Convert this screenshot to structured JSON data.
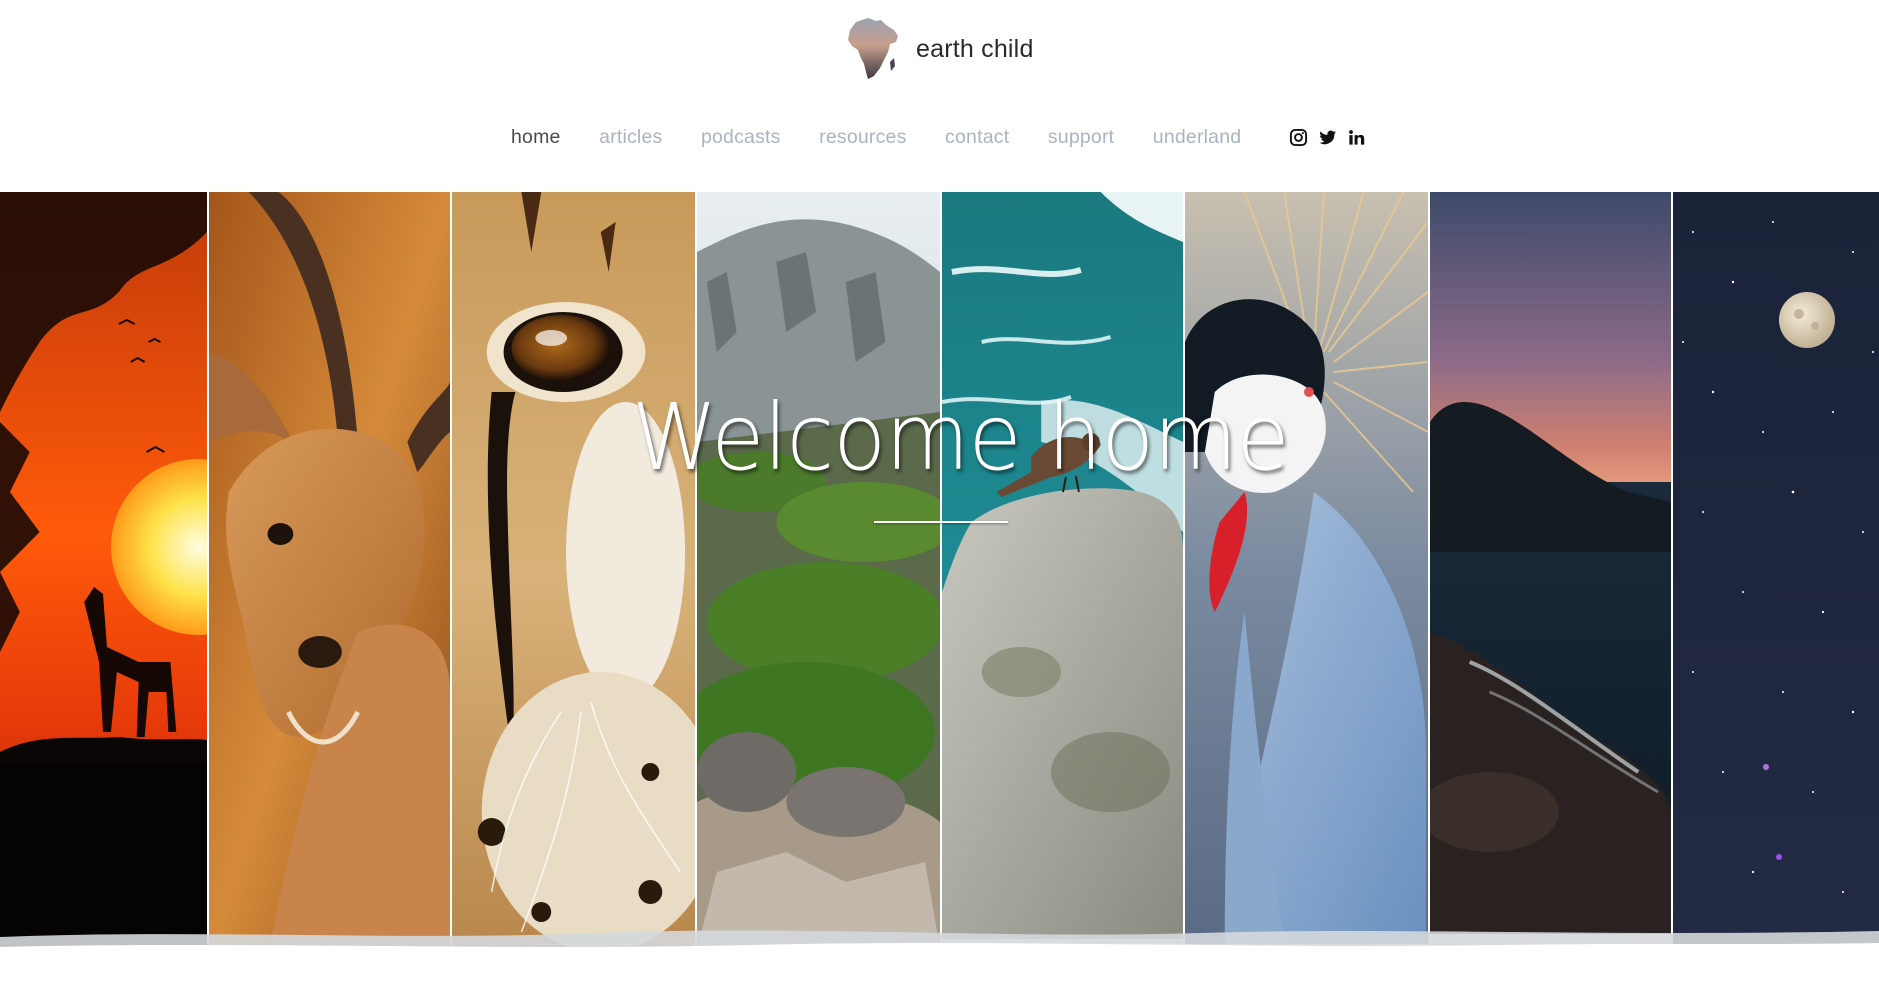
{
  "site": {
    "title": "earth child",
    "logo_icon": "africa-map-icon"
  },
  "nav": {
    "items": [
      {
        "label": "home",
        "active": true
      },
      {
        "label": "articles",
        "active": false
      },
      {
        "label": "podcasts",
        "active": false
      },
      {
        "label": "resources",
        "active": false
      },
      {
        "label": "contact",
        "active": false
      },
      {
        "label": "support",
        "active": false
      },
      {
        "label": "underland",
        "active": false
      }
    ],
    "socials": [
      "instagram-icon",
      "twitter-icon",
      "linkedin-icon"
    ]
  },
  "hero": {
    "title": "Welcome home",
    "panels": [
      "sunset-giraffe-image",
      "impala-image",
      "cheetah-eye-image",
      "rocky-mountain-image",
      "bird-on-rock-image",
      "crowned-crane-image",
      "coastal-dusk-image",
      "night-sky-moon-image"
    ]
  },
  "colors": {
    "nav_inactive": "#a9b4c2",
    "nav_active": "#4a4a4a",
    "title_text": "#2a2a2a"
  }
}
